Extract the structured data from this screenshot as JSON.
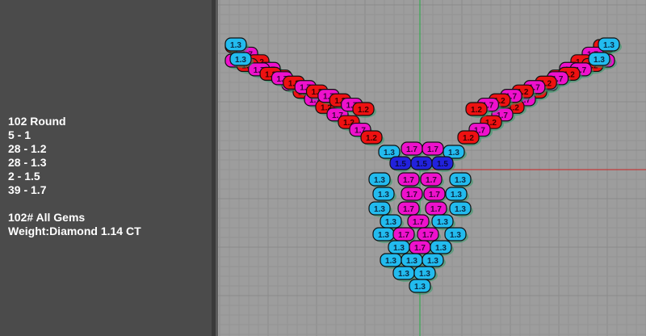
{
  "stats_panel": {
    "lines": [
      "102 Round",
      "5 - 1",
      "28 - 1.2",
      "28 - 1.3",
      "2 - 1.5",
      "39 - 1.7",
      "",
      "102# All Gems",
      "Weight:Diamond 1.14 CT"
    ]
  },
  "colors": {
    "size_1_3": "#22bbee",
    "size_1_2": "#ee1111",
    "size_1_7": "#ee11cc",
    "size_1_5": "#2222dd",
    "prong": "#2f9a6a",
    "axis_x": "#cc2222",
    "axis_y": "#22aa44",
    "grid_major": "#8a8a8a",
    "grid_minor": "#949494"
  },
  "gem_labels": {
    "small": "1.3",
    "medium": "1.2",
    "large": "1.7",
    "center": "1.5",
    "tiny": "1"
  }
}
